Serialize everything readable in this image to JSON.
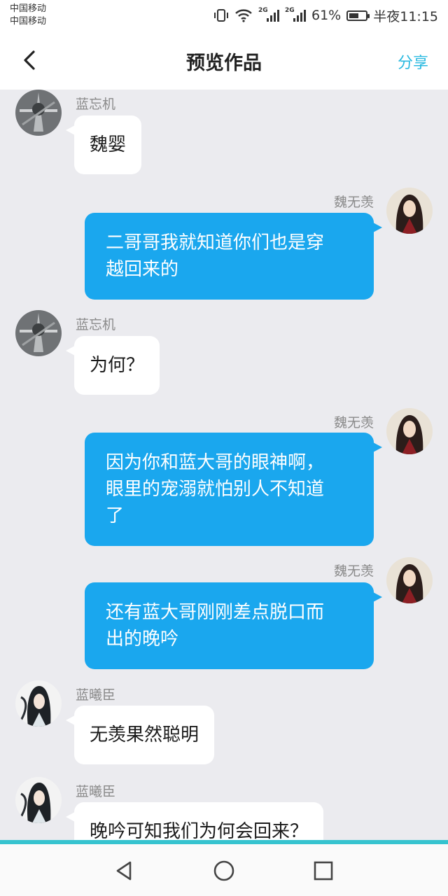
{
  "status_bar": {
    "carrier_1": "中国移动",
    "carrier_2": "中国移动",
    "network_1": "2G",
    "network_2": "2G",
    "battery": "61%",
    "battery_level": 0.61,
    "time": "半夜11:15"
  },
  "header": {
    "title": "预览作品",
    "share_label": "分享"
  },
  "messages": [
    {
      "sender": "蓝忘机",
      "side": "left",
      "avatar": "figure-avatar",
      "lines": [
        "魏婴"
      ]
    },
    {
      "sender": "魏无羡",
      "side": "right",
      "avatar": "character-avatar",
      "lines": [
        "二哥哥我就知道你们也是穿",
        "越回来的"
      ]
    },
    {
      "sender": "蓝忘机",
      "side": "left",
      "avatar": "figure-avatar",
      "lines": [
        "为何？"
      ]
    },
    {
      "sender": "魏无羡",
      "side": "right",
      "avatar": "character-avatar",
      "lines": [
        "因为你和蓝大哥的眼神啊，",
        "眼里的宠溺就怕别人不知道",
        "了"
      ]
    },
    {
      "sender": "魏无羡",
      "side": "right",
      "avatar": "character-avatar",
      "lines": [
        "还有蓝大哥刚刚差点脱口而",
        "出的晚吟"
      ]
    },
    {
      "sender": "蓝曦臣",
      "side": "left",
      "avatar": "character-avatar",
      "lines": [
        "无羡果然聪明"
      ]
    },
    {
      "sender": "蓝曦臣",
      "side": "left",
      "avatar": "character-avatar",
      "lines": [
        "晚吟可知我们为何会回来？"
      ]
    }
  ],
  "colors": {
    "accent": "#29b9e0",
    "bubble_right": "#1aa7ee",
    "chat_background": "#ebebef",
    "nav_accent": "#36c3cf"
  },
  "nav": {
    "back_icon": "triangle-back-icon",
    "home_icon": "circle-home-icon",
    "recents_icon": "square-recents-icon"
  }
}
